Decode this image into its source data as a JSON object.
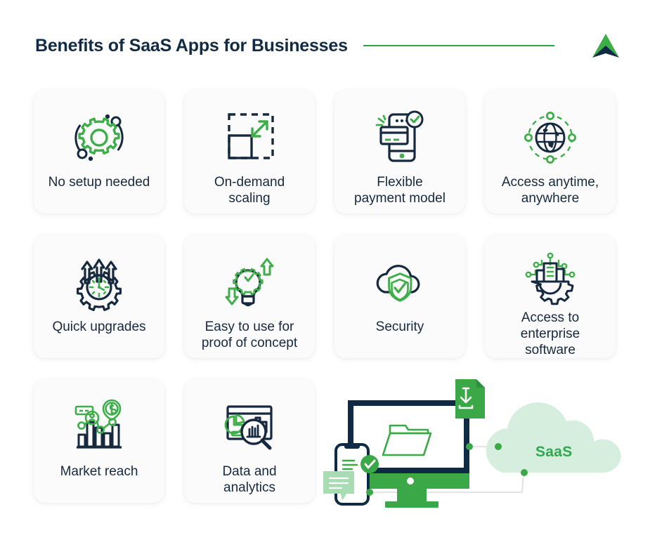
{
  "header": {
    "title": "Benefits of SaaS Apps for Businesses",
    "divider_color": "#2ea44f",
    "logo_name": "arrow-logo",
    "logo_colors": {
      "green": "#3eae49",
      "navy": "#0f2a44"
    }
  },
  "theme": {
    "background": "#ffffff",
    "card_background": "#fbfbfc",
    "navy": "#16293f",
    "green": "#3eae49",
    "cloud_fill": "#d6eedd",
    "saas_text": "#2fa84f"
  },
  "cards": [
    {
      "label": "No setup needed",
      "icon": "gear-orbit-icon"
    },
    {
      "label": "On-demand\nscaling",
      "icon": "resize-square-icon"
    },
    {
      "label": "Flexible\npayment model",
      "icon": "phone-payment-icon"
    },
    {
      "label": "Access anytime,\nanywhere",
      "icon": "globe-network-icon"
    },
    {
      "label": "Quick upgrades",
      "icon": "gear-clock-arrows-icon"
    },
    {
      "label": "Easy to use for\nproof of concept",
      "icon": "lightbulb-gear-icon"
    },
    {
      "label": "Security",
      "icon": "cloud-shield-icon"
    },
    {
      "label": "Access to enterprise\nsoftware",
      "icon": "enterprise-gear-icon"
    },
    {
      "label": "Market reach",
      "icon": "bar-chart-dollar-icon"
    },
    {
      "label": "Data and\nanalytics",
      "icon": "dashboard-magnifier-icon"
    }
  ],
  "illustration": {
    "cloud_label": "SaaS",
    "elements": [
      "desktop-monitor",
      "folder-icon",
      "download-file-icon",
      "smartphone",
      "check-badge-icon",
      "chat-bubble-icon",
      "cloud-shape",
      "connector-lines"
    ]
  }
}
